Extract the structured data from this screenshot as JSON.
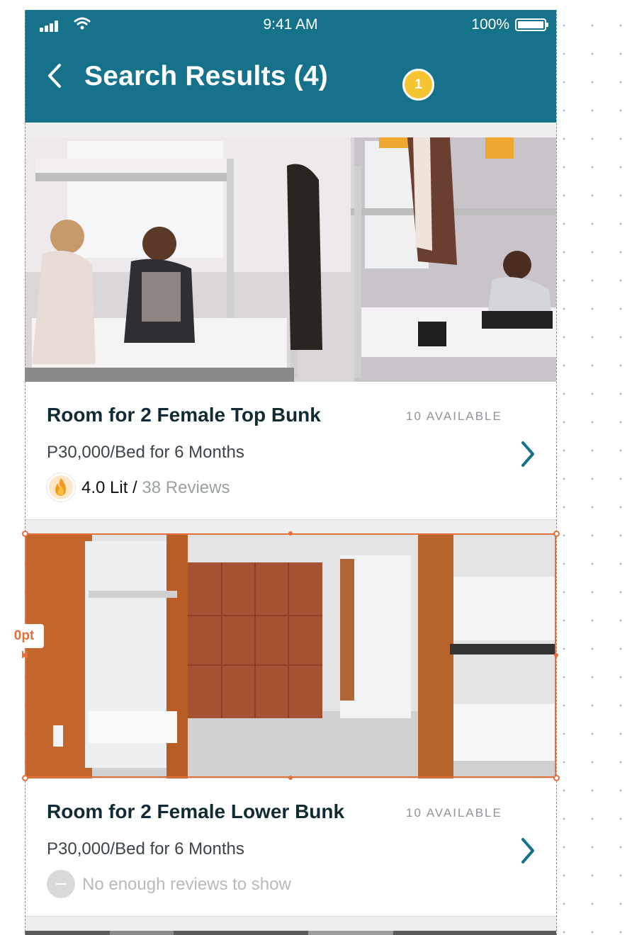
{
  "status_bar": {
    "time": "9:41 AM",
    "battery": "100%"
  },
  "header": {
    "title": "Search Results (4)",
    "back_icon": "chevron-left-icon"
  },
  "annotation": {
    "badge": "1",
    "spacing_label": "0pt"
  },
  "colors": {
    "header_bg": "#16728b",
    "accent": "#16728b",
    "selection": "#e4703c",
    "badge": "#f5c531"
  },
  "listings": [
    {
      "name": "Room for 2 Female Top Bunk",
      "availability": "10 AVAILABLE",
      "price": "P30,000/Bed for 6 Months",
      "rating": "4.0 Lit",
      "separator": " / ",
      "reviews": "38 Reviews",
      "rating_icon": "fire-icon"
    },
    {
      "name": "Room for 2 Female Lower Bunk",
      "availability": "10 AVAILABLE",
      "price": "P30,000/Bed for 6 Months",
      "no_reviews": "No enough reviews to show",
      "rating_icon": "minus-icon"
    }
  ]
}
